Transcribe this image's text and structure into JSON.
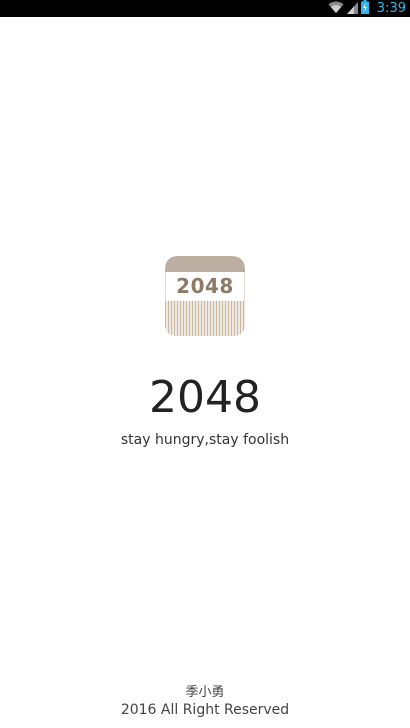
{
  "status_bar": {
    "time": "3:39",
    "icons": [
      "wifi-icon",
      "signal-icon",
      "battery-charging-icon"
    ],
    "time_color": "#33b5e5"
  },
  "logo": {
    "text": "2048",
    "top_color": "#bbada0",
    "text_color": "#8f7a66"
  },
  "title": "2048",
  "slogan": "stay hungry,stay foolish",
  "footer": {
    "author": "季小勇",
    "copyright": "2016 All Right Reserved"
  }
}
